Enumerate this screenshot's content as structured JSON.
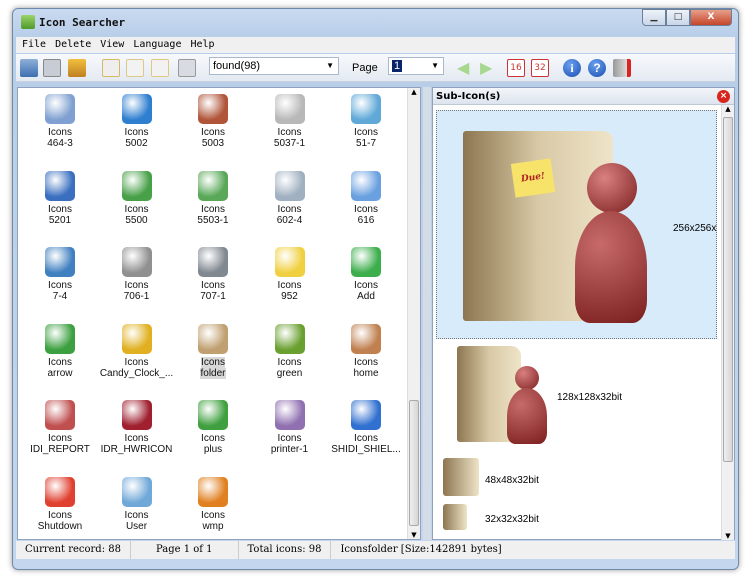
{
  "window": {
    "title": "Icon Searcher"
  },
  "menu": [
    "File",
    "Delete",
    "View",
    "Language",
    "Help"
  ],
  "toolbar": {
    "search_combo": "found(98)",
    "page_label": "Page",
    "page_value": "1"
  },
  "icons": [
    {
      "l1": "Icons",
      "l2": "464-3",
      "color": "#7fa0d0"
    },
    {
      "l1": "Icons",
      "l2": "5002",
      "color": "#2f7fd0"
    },
    {
      "l1": "Icons",
      "l2": "5003",
      "color": "#b0553a"
    },
    {
      "l1": "Icons",
      "l2": "5037-1",
      "color": "#b8b8b8"
    },
    {
      "l1": "Icons",
      "l2": "51-7",
      "color": "#5fa8d8"
    },
    {
      "l1": "Icons",
      "l2": "5201",
      "color": "#3a6fc0"
    },
    {
      "l1": "Icons",
      "l2": "5500",
      "color": "#48a048"
    },
    {
      "l1": "Icons",
      "l2": "5503-1",
      "color": "#58a858"
    },
    {
      "l1": "Icons",
      "l2": "602-4",
      "color": "#a0b0c0"
    },
    {
      "l1": "Icons",
      "l2": "616",
      "color": "#6aa0e0"
    },
    {
      "l1": "Icons",
      "l2": "7-4",
      "color": "#4080c0"
    },
    {
      "l1": "Icons",
      "l2": "706-1",
      "color": "#909090"
    },
    {
      "l1": "Icons",
      "l2": "707-1",
      "color": "#808890"
    },
    {
      "l1": "Icons",
      "l2": "952",
      "color": "#f0d040"
    },
    {
      "l1": "Icons",
      "l2": "Add",
      "color": "#3cae4c"
    },
    {
      "l1": "Icons",
      "l2": "arrow",
      "color": "#3ca040"
    },
    {
      "l1": "Icons",
      "l2": "Candy_Clock_...",
      "color": "#e0b020"
    },
    {
      "l1": "Icons",
      "l2": "folder",
      "color": "#c0a070",
      "selected": true
    },
    {
      "l1": "Icons",
      "l2": "green",
      "color": "#6aa030"
    },
    {
      "l1": "Icons",
      "l2": "home",
      "color": "#c08050"
    },
    {
      "l1": "Icons",
      "l2": "IDI_REPORT",
      "color": "#c05050"
    },
    {
      "l1": "Icons",
      "l2": "IDR_HWRICON",
      "color": "#a02030"
    },
    {
      "l1": "Icons",
      "l2": "plus",
      "color": "#40a040"
    },
    {
      "l1": "Icons",
      "l2": "printer-1",
      "color": "#9070b0"
    },
    {
      "l1": "Icons",
      "l2": "SHIDI_SHIEL...",
      "color": "#3070d0"
    },
    {
      "l1": "Icons",
      "l2": "Shutdown",
      "color": "#e04030"
    },
    {
      "l1": "Icons",
      "l2": "User",
      "color": "#70a8d8"
    },
    {
      "l1": "Icons",
      "l2": "wmp",
      "color": "#e08020"
    }
  ],
  "subicons": {
    "title": "Sub-Icon(s)",
    "sizes": [
      "256x256x",
      "128x128x32bit",
      "48x48x32bit",
      "32x32x32bit"
    ],
    "note_text": "Due!"
  },
  "status": {
    "record": "Current record: 88",
    "page": "Page 1 of 1",
    "total": "Total icons: 98",
    "file": "Iconsfolder [Size:142891 bytes]"
  }
}
